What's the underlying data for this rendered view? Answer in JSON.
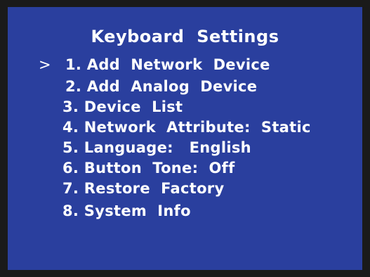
{
  "menu": {
    "title": "Keyboard  Settings",
    "cursor": ">",
    "items": [
      {
        "label": "1. Add  Network  Device"
      },
      {
        "label": "2. Add  Analog  Device"
      },
      {
        "label": "3. Device  List"
      },
      {
        "label": "4. Network  Attribute:  Static"
      },
      {
        "label": "5. Language:   English"
      },
      {
        "label": "6. Button  Tone:  Off"
      },
      {
        "label": "7. Restore  Factory"
      },
      {
        "label": "8. System  Info"
      }
    ]
  },
  "colors": {
    "screen_background": "#2a3f9e",
    "frame": "#1a1a1a",
    "text": "#ffffff"
  }
}
